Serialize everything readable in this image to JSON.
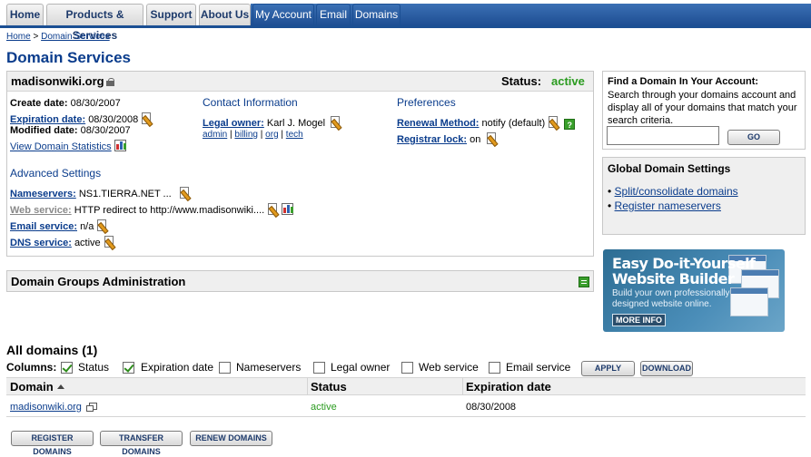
{
  "nav": {
    "tabs": [
      {
        "label": "Home"
      },
      {
        "label": "Products & Services"
      },
      {
        "label": "Support"
      },
      {
        "label": "About Us"
      },
      {
        "label": "My Account"
      },
      {
        "label": "Email"
      },
      {
        "label": "Domains"
      }
    ]
  },
  "breadcrumb": {
    "home": "Home",
    "sep": ">",
    "current": "Domain Services"
  },
  "page_title": "Domain Services",
  "domain": {
    "name": "madisonwiki.org",
    "status_label": "Status:",
    "status_value": "active",
    "create_label": "Create date:",
    "create_value": "08/30/2007",
    "expiration_label": "Expiration date:",
    "expiration_value": "08/30/2008",
    "modified_label": "Modified date:",
    "modified_value": "08/30/2007",
    "view_stats": "View Domain Statistics"
  },
  "contact": {
    "heading": "Contact Information",
    "legal_owner_label": "Legal owner:",
    "legal_owner_value": "Karl J. Mogel",
    "links": [
      "admin",
      "billing",
      "org",
      "tech"
    ],
    "sep": "|"
  },
  "preferences": {
    "heading": "Preferences",
    "renewal_label": "Renewal Method:",
    "renewal_value": "notify (default)",
    "registrar_lock_label": "Registrar lock:",
    "registrar_lock_value": "on"
  },
  "advanced": {
    "heading": "Advanced Settings",
    "nameservers_label": "Nameservers:",
    "nameservers_value": "NS1.TIERRA.NET ...",
    "web_service_label": "Web service:",
    "web_service_value": "HTTP redirect to http://www.madisonwiki....",
    "email_service_label": "Email service:",
    "email_service_value": "n/a",
    "dns_service_label": "DNS service:",
    "dns_service_value": "active"
  },
  "groups": {
    "title": "Domain Groups Administration"
  },
  "find": {
    "title": "Find a Domain In Your Account:",
    "text": "Search through your domains account and display all of your domains that match your search criteria.",
    "input_value": "",
    "go_label": "GO"
  },
  "global": {
    "title": "Global Domain Settings",
    "items": [
      "Split/consolidate domains",
      "Register nameservers"
    ]
  },
  "ad": {
    "headline_1": "Easy Do-it-Yourself",
    "headline_2": "Website Builder",
    "text_1": "Build your own professionally",
    "text_2": "designed website online.",
    "button": "MORE INFO"
  },
  "all_domains": {
    "title": "All domains (1)",
    "columns_label": "Columns:",
    "columns": [
      {
        "label": "Status",
        "checked": true
      },
      {
        "label": "Expiration date",
        "checked": true
      },
      {
        "label": "Nameservers",
        "checked": false
      },
      {
        "label": "Legal owner",
        "checked": false
      },
      {
        "label": "Web service",
        "checked": false
      },
      {
        "label": "Email service",
        "checked": false
      }
    ],
    "apply_label": "APPLY",
    "download_label": "DOWNLOAD",
    "headers": [
      "Domain",
      "Status",
      "Expiration date"
    ],
    "rows": [
      {
        "domain": "madisonwiki.org",
        "status": "active",
        "expiration": "08/30/2008"
      }
    ],
    "buttons": [
      "REGISTER DOMAINS",
      "TRANSFER DOMAINS",
      "RENEW DOMAINS"
    ]
  },
  "colors": {
    "link": "#0a3c8c",
    "active": "#2a9b1f",
    "nav_blue": "#1b4f93"
  }
}
